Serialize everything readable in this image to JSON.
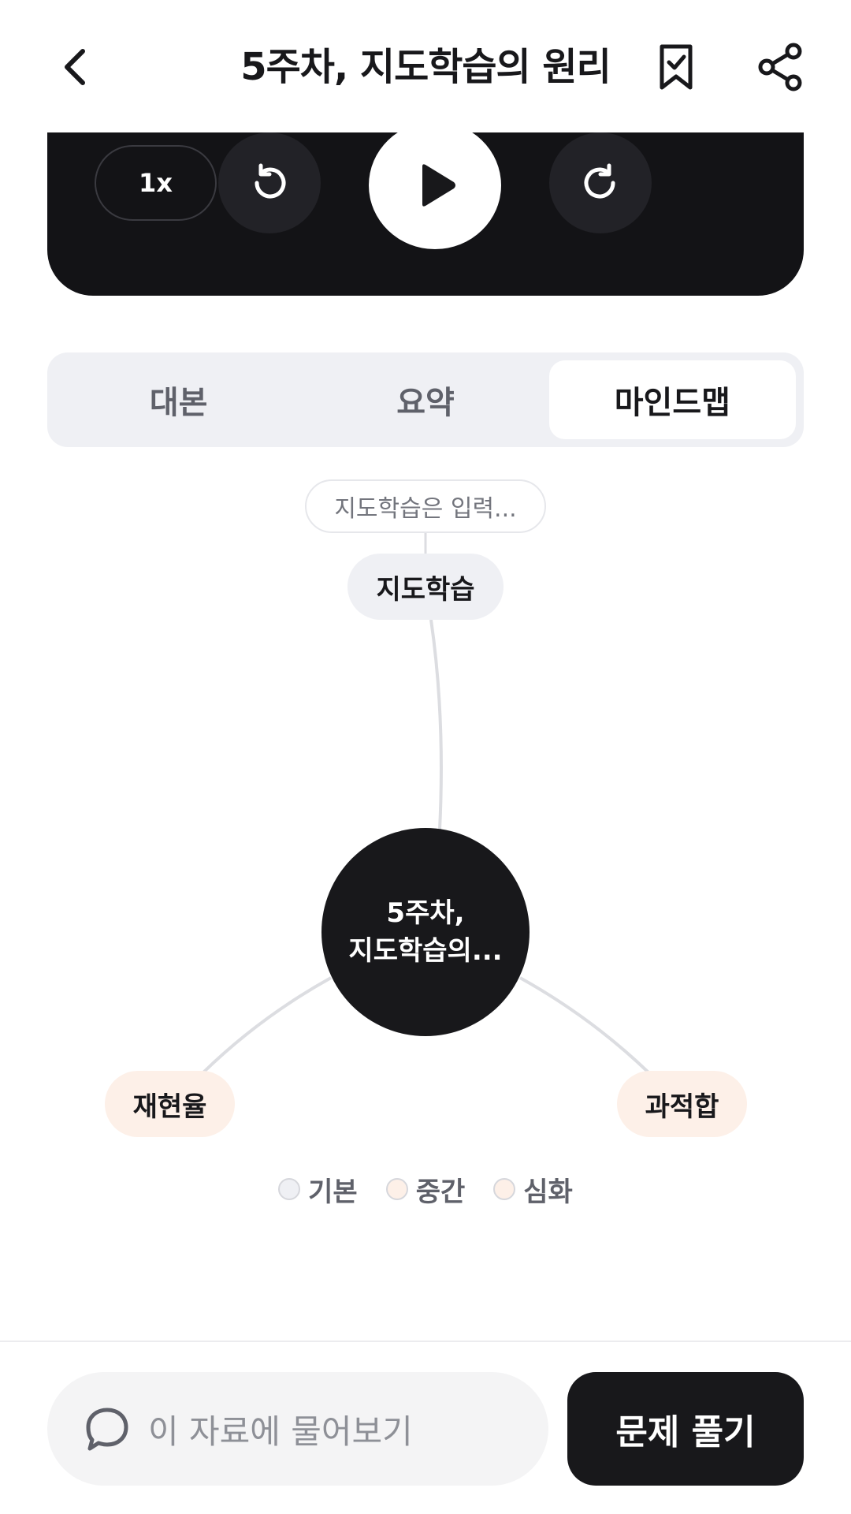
{
  "header": {
    "title": "5주차, 지도학습의 원리",
    "back_icon": "chevron-left-icon",
    "bookmark_icon": "bookmark-check-icon",
    "share_icon": "share-icon"
  },
  "player": {
    "speed_label": "1x",
    "rewind_icon": "rotate-ccw-icon",
    "play_icon": "play-icon",
    "forward_icon": "rotate-cw-icon"
  },
  "tabs": [
    {
      "label": "대본",
      "active": false
    },
    {
      "label": "요약",
      "active": false
    },
    {
      "label": "마인드맵",
      "active": true
    }
  ],
  "mindmap": {
    "center_line1": "5주차,",
    "center_line2": "지도학습의...",
    "note": "지도학습은 입력...",
    "nodes": [
      {
        "label": "지도학습",
        "level": "기본"
      },
      {
        "label": "재현율",
        "level": "중간"
      },
      {
        "label": "과적합",
        "level": "중간"
      }
    ]
  },
  "legend": [
    {
      "label": "기본",
      "color": "#eff0f4"
    },
    {
      "label": "중간",
      "color": "#fdf0e8"
    },
    {
      "label": "심화",
      "color": "#fdf0e8"
    }
  ],
  "bottom": {
    "ask_label": "이 자료에 물어보기",
    "ask_icon": "chat-bubble-icon",
    "solve_label": "문제 풀기"
  }
}
